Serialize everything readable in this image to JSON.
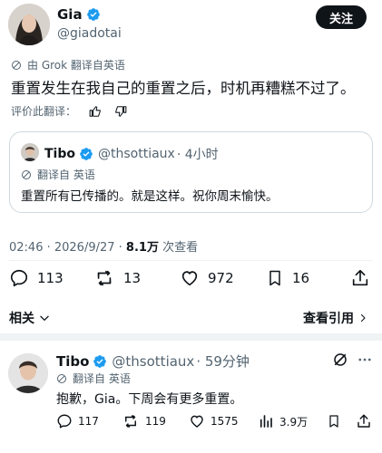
{
  "header": {
    "display_name": "Gia",
    "handle": "@giadotai",
    "follow_label": "关注"
  },
  "tweet": {
    "translation_note": "由 Grok 翻译自英语",
    "text": "重置发生在我自己的重置之后，时机再糟糕不过了。",
    "rate_label": "评价此翻译：",
    "timestamp": "02:46 · 2026/9/27 · ",
    "views_count": "8.1万",
    "views_label": " 次查看",
    "stats": {
      "replies": "113",
      "retweets": "13",
      "likes": "972",
      "bookmarks": "16"
    }
  },
  "quote": {
    "display_name": "Tibo",
    "handle": "@thsottiaux",
    "time": "· 4小时",
    "translation_note": "翻译自 英语",
    "text": "重置所有已传播的。就是这样。祝你周末愉快。"
  },
  "related": {
    "related_label": "相关",
    "view_quotes_label": "查看引用"
  },
  "reply": {
    "display_name": "Tibo",
    "handle": "@thsottiaux",
    "time": "· 59分钟",
    "translation_note": "翻译自 英语",
    "text": "抱歉，Gia。下周会有更多重置。",
    "stats": {
      "replies": "117",
      "retweets": "119",
      "likes": "1575",
      "views": "3.9万"
    }
  },
  "colors": {
    "brand_blue": "#1d9bf0",
    "text": "#0f1419",
    "muted": "#536471",
    "border": "#cfd9de"
  },
  "icons": [
    "verified-badge-icon",
    "translate-icon",
    "thumbs-up-icon",
    "thumbs-down-icon",
    "reply-icon",
    "retweet-icon",
    "like-icon",
    "bookmark-icon",
    "share-icon",
    "chevron-down-icon",
    "chevron-right-icon",
    "grok-icon",
    "more-icon",
    "views-icon"
  ]
}
